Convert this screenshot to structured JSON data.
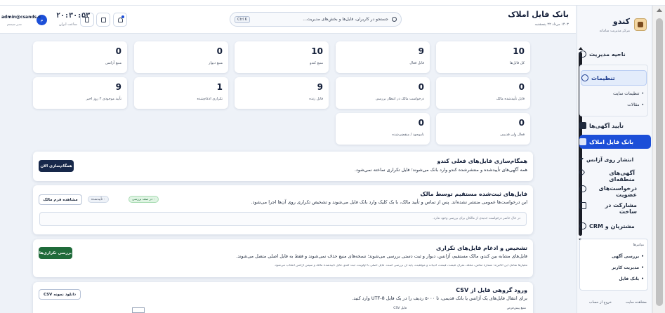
{
  "app": {
    "brand_title": "کندو",
    "brand_subtitle": "مرکز مدیریت سامانه"
  },
  "header": {
    "title": "بانک فایل املاک",
    "date": "۱۴۰۳ مرداد ۲۲ پنجشنبه",
    "search_placeholder": "جستجو در کاربران، فایل‌ها و بخش‌های مدیریت...",
    "search_shortcut": "Ctrl K",
    "clock": "۲۰:۳۰:۵۳",
    "clock_sub": "ساعت ایران",
    "avatar_letter": "م",
    "user_email": "admin@csands.c",
    "user_sub": "مدیر سیستم"
  },
  "sidebar": {
    "items": [
      {
        "label": "ناحیه مدیریت"
      },
      {
        "label": "تنظیمات"
      },
      {
        "label": "تنظیمات سایت"
      },
      {
        "label": "مقالات"
      },
      {
        "label": "تأیید آگهی‌ها"
      },
      {
        "label": "بانک فایل املاک"
      },
      {
        "label": "انتشار روی آژانس"
      },
      {
        "label": "آگهی‌های منطقه‌ای"
      },
      {
        "label": "درخواست‌های عضویت"
      },
      {
        "label": "مشارکت در ساخت"
      },
      {
        "label": "مشتریان و CRM"
      }
    ],
    "recent_title": "میانبرها",
    "recent": [
      {
        "label": "بررسی آگهی"
      },
      {
        "label": "مدیریت کاربر"
      },
      {
        "label": "بانک فایل"
      }
    ],
    "footer_site": "مشاهده سایت",
    "footer_logout": "خروج از حساب"
  },
  "stats": [
    {
      "value": "10",
      "label": "کل فایل‌ها"
    },
    {
      "value": "9",
      "label": "فایل فعال"
    },
    {
      "value": "10",
      "label": "منبع کندو"
    },
    {
      "value": "0",
      "label": "منبع دیوار"
    },
    {
      "value": "0",
      "label": "منبع آژانس"
    },
    {
      "value": "0",
      "label": "فایل تأییدشده مالک"
    },
    {
      "value": "0",
      "label": "درخواست مالک در انتظار بررسی"
    },
    {
      "value": "9",
      "label": "فایل زنده"
    },
    {
      "value": "1",
      "label": "تکراری ادغام‌شده"
    },
    {
      "value": "9",
      "label": "تأیید موجودی ۳ روز اخیر"
    },
    {
      "value": "0",
      "label": "فعال ولی قدیمی"
    },
    {
      "value": "0",
      "label": "ناموجود / منقضی‌شده"
    }
  ],
  "panels": {
    "sync": {
      "title": "همگام‌سازی فایل‌های فعلی کندو",
      "desc": "همه آگهی‌های تأییدشده و منتشرشده کندو وارد بانک می‌شوند؛ فایل تکراری ساخته نمی‌شود.",
      "button": "همگام‌سازی الان"
    },
    "owner": {
      "title": "فایل‌های ثبت‌شده مستقیم توسط مالک",
      "desc": "این درخواست‌ها عمومی منتشر نشده‌اند. پس از تماس و تأیید مالک، با یک کلیک وارد بانک فایل می‌شوند و تشخیص تکراری روی آن‌ها اجرا می‌شود.",
      "chip_pending": "۰ در صف بررسی",
      "chip_approved": "۰ تأییدشده",
      "button": "مشاهده فرم مالک",
      "empty": "در حال حاضر درخواست جدیدی از مالکان برای بررسی وجود ندارد."
    },
    "dedupe": {
      "title": "تشخیص و ادغام فایل‌های تکراری",
      "desc": "فایل‌های مشابه بین کندو، مالک مستقیم، آژانس، دیوار و ثبت دستی بررسی می‌شوند؛ نسخه‌های منبع حذف نمی‌شوند و فقط به فایل اصلی متصل می‌شوند.",
      "note": "معیارها شامل این آنالیزند: شماره تماس، محله، متراژ، قیمت، قیمت، ادبیات و موقعیت، پایه آن بررسی است. فایل اصلی با اولویت، ثبت کندو، فایل تأییدشده مالک و سپس آژانس انتخاب می‌شود.",
      "button": "بررسی تکراری‌ها"
    },
    "csv": {
      "title": "ورود گروهی فایل از CSV",
      "desc": "برای انتقال فایل‌های یک آژانس یا بانک قدیمی، تا ۵۰۰۰ ردیف را در یک فایل UTF-8 وارد کنید.",
      "button": "دانلود نمونه CSV",
      "col_file": "فایل CSV",
      "col_source": "منبع پیش‌فرض"
    }
  },
  "colors": {
    "primary": "#1c4fd8",
    "dark_button": "#17284a",
    "green_button": "#1f6b3a",
    "chip_green_bg": "#dff4e3",
    "chip_green_text": "#1f6b3a"
  }
}
